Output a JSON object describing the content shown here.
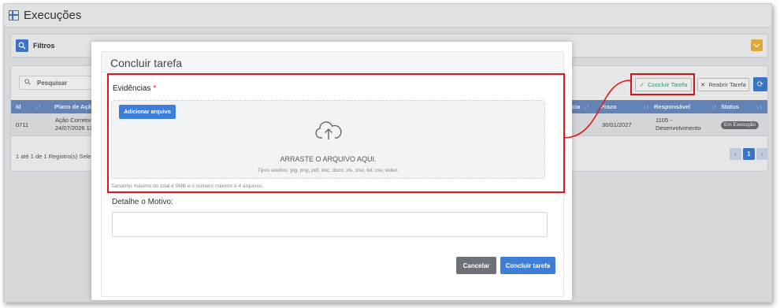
{
  "page": {
    "title": "Execuções"
  },
  "filters": {
    "label": "Filtros"
  },
  "toolbar": {
    "search_placeholder": "Pesquisar",
    "concluir_label": "Concluir Tarefa",
    "reabrir_label": "Reabrir Tarefa"
  },
  "table": {
    "columns": [
      "Id",
      "Plano de Ação",
      "cia",
      "Prazo",
      "Responsável",
      "Status"
    ],
    "row": {
      "id": "0711",
      "plano": "Ação Corretiva",
      "data": "24/07/2026 13",
      "prazo": "30/01/2027",
      "responsavel_1": "1105 -",
      "responsavel_2": "Desenvolvimento",
      "status": "Em Execução"
    },
    "footer": "1 até 1 de 1 Registro(s)  Sele",
    "page_number": "1"
  },
  "modal": {
    "title": "Concluir tarefa",
    "evidencias_label": "Evidências",
    "required_mark": "*",
    "add_file_label": "Adicionar arquivo",
    "drop_text": "ARRASTE O ARQUIVO AQUI.",
    "accepted_text": "Tipos aceitos: jpg, png, pdf, doc, docx, xls, xlsx, txt, csv, video.",
    "size_note": "Tamanho máximo do total é 5MB e o número máximo é 4 arquivos.",
    "motivo_label": "Detalhe o Motivo:",
    "cancel_label": "Cancelar",
    "confirm_label": "Concluir tarefa"
  },
  "colors": {
    "accent": "#3e7ed8",
    "highlight": "#e3141b",
    "table_header": "#6c8fc6",
    "warning": "#f1b73a"
  }
}
